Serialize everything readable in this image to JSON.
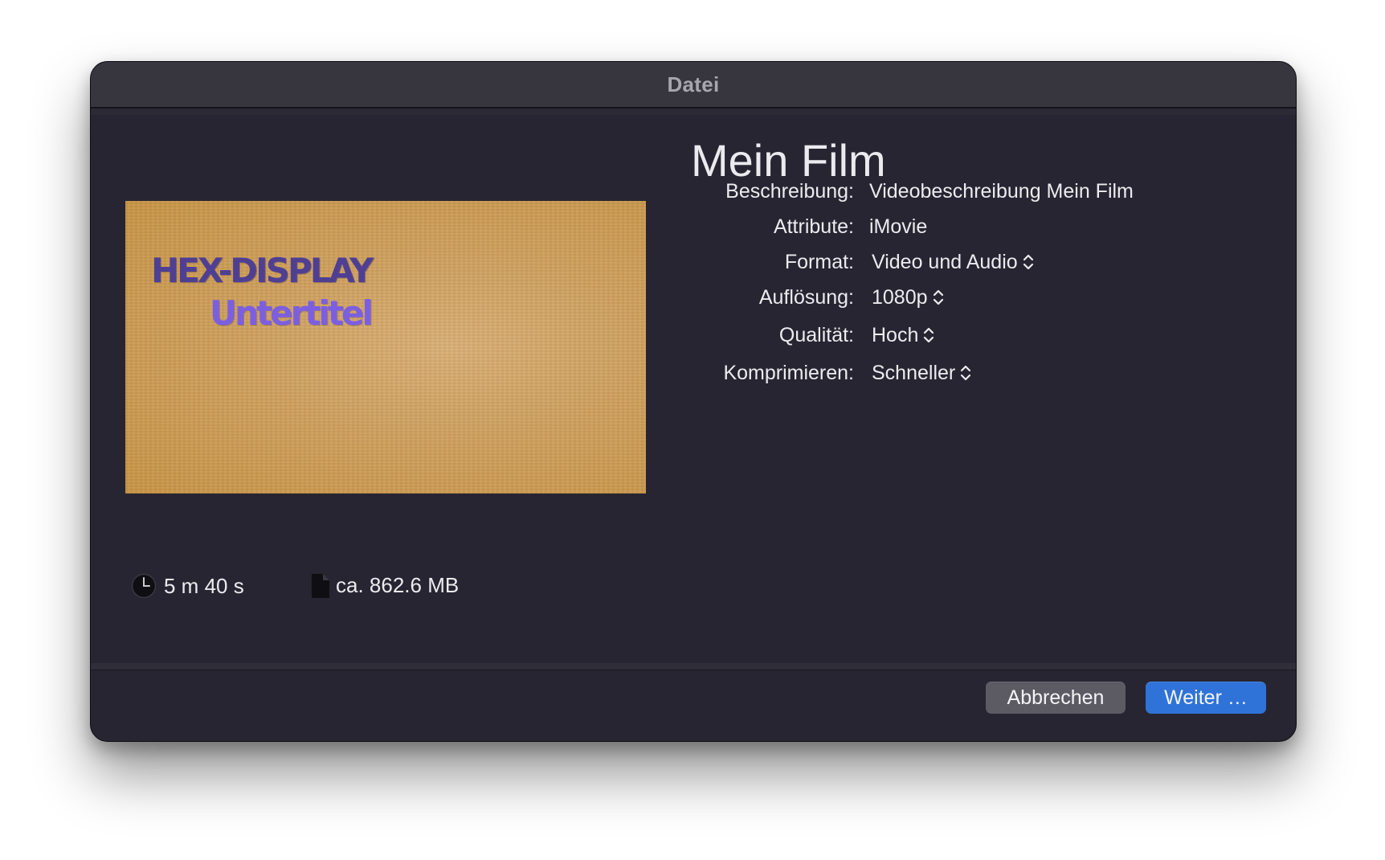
{
  "window": {
    "title": "Datei"
  },
  "preview": {
    "title_text": "HEX-DISPLAY",
    "subtitle_text": "Untertitel",
    "background_color": "#cea163"
  },
  "movie": {
    "title": "Mein Film"
  },
  "properties": {
    "description": {
      "label": "Beschreibung:",
      "value": "Videobeschreibung Mein Film"
    },
    "attributes": {
      "label": "Attribute:",
      "value": "iMovie"
    },
    "format": {
      "label": "Format:",
      "value": "Video und Audio"
    },
    "resolution": {
      "label": "Auflösung:",
      "value": "1080p"
    },
    "quality": {
      "label": "Qualität:",
      "value": "Hoch"
    },
    "compress": {
      "label": "Komprimieren:",
      "value": "Schneller"
    }
  },
  "meta": {
    "duration": "5 m 40 s",
    "duration_icon": "clock-icon",
    "filesize": "ca. 862.6 MB",
    "filesize_icon": "document-icon"
  },
  "buttons": {
    "cancel": "Abbrechen",
    "next": "Weiter …"
  },
  "colors": {
    "accent": "#2f73d8",
    "window_bg": "#272531",
    "titlebar_bg": "#37353e"
  }
}
